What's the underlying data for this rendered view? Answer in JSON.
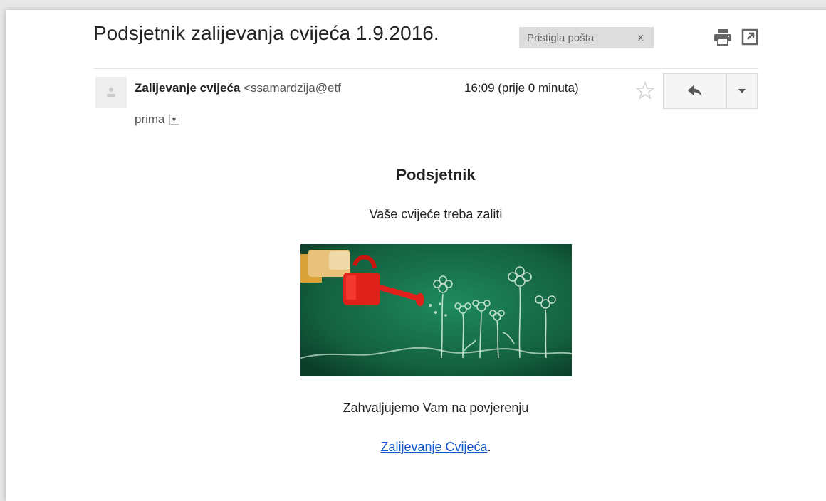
{
  "email": {
    "subject": "Podsjetnik zalijevanja cvijeća 1.9.2016.",
    "label": {
      "text": "Pristigla pošta",
      "remove": "x"
    },
    "toolbar": {
      "print_icon": "print-icon",
      "popout_icon": "open-in-new-window-icon"
    },
    "sender": {
      "name": "Zalijevanje cvijeća",
      "email": "<ssamardzija@etf"
    },
    "recipient": {
      "label": "prima",
      "dropdown_icon": "chevron-down-icon"
    },
    "timestamp": "16:09 (prije 0 minuta)",
    "actions": {
      "star_icon": "star-icon",
      "reply_icon": "reply-icon",
      "more_icon": "caret-down-icon"
    }
  },
  "body": {
    "heading": "Podsjetnik",
    "text": "Vaše cvijeće treba zaliti",
    "image_icon": "watering-can-flowers-illustration",
    "thanks": "Zahvaljujemo Vam na povjerenju",
    "link_text": "Zalijevanje Cvijeća",
    "link_suffix": "."
  },
  "colors": {
    "link": "#1155cc",
    "label_chip_bg": "#dddddd",
    "image_green": "#1e7a52",
    "watering_can_red": "#e0201a"
  }
}
